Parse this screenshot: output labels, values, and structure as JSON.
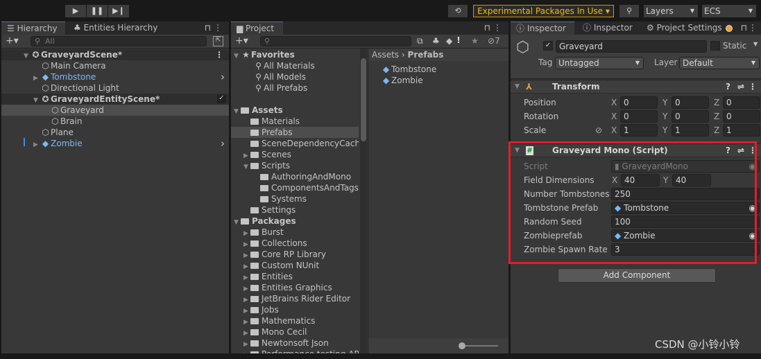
{
  "toolbar": {
    "play": "▶",
    "pause": "❚❚",
    "step": "▶❙",
    "history_icon": "history-icon",
    "experimental": "Experimental Packages In Use ▾",
    "search_icon": "search-icon",
    "layers": "Layers",
    "ecs": "ECS"
  },
  "hierarchy": {
    "tabs": [
      "Hierarchy",
      "Entities Hierarchy"
    ],
    "search_placeholder": "All",
    "rows": [
      {
        "label": "GraveyardScene*",
        "depth": 0,
        "kind": "scene",
        "expanded": true,
        "bold": true
      },
      {
        "label": "Main Camera",
        "depth": 1,
        "kind": "go"
      },
      {
        "label": "Tombstone",
        "depth": 1,
        "kind": "prefab",
        "collapsed": true
      },
      {
        "label": "Directional Light",
        "depth": 1,
        "kind": "go"
      },
      {
        "label": "GraveyardEntityScene*",
        "depth": 1,
        "kind": "scene",
        "expanded": true,
        "checked": true
      },
      {
        "label": "Graveyard",
        "depth": 2,
        "kind": "go",
        "selected": true
      },
      {
        "label": "Brain",
        "depth": 2,
        "kind": "go"
      },
      {
        "label": "Plane",
        "depth": 1,
        "kind": "go"
      },
      {
        "label": "Zombie",
        "depth": 1,
        "kind": "prefab",
        "collapsed": true
      }
    ]
  },
  "project": {
    "tab": "Project",
    "hidden_count": "7",
    "breadcrumb": [
      "Assets",
      "Prefabs"
    ],
    "tree": [
      {
        "label": "Favorites",
        "depth": 0,
        "kind": "star",
        "expanded": true,
        "bold": true
      },
      {
        "label": "All Materials",
        "depth": 1,
        "kind": "search"
      },
      {
        "label": "All Models",
        "depth": 1,
        "kind": "search"
      },
      {
        "label": "All Prefabs",
        "depth": 1,
        "kind": "search"
      },
      {
        "label": "",
        "depth": 0,
        "kind": "blank"
      },
      {
        "label": "Assets",
        "depth": 0,
        "kind": "folder",
        "expanded": true,
        "bold": true
      },
      {
        "label": "Materials",
        "depth": 1,
        "kind": "folder"
      },
      {
        "label": "Prefabs",
        "depth": 1,
        "kind": "folder",
        "selected": true
      },
      {
        "label": "SceneDependencyCache",
        "depth": 1,
        "kind": "folder"
      },
      {
        "label": "Scenes",
        "depth": 1,
        "kind": "folder",
        "collapsed": true
      },
      {
        "label": "Scripts",
        "depth": 1,
        "kind": "folder",
        "expanded": true
      },
      {
        "label": "AuthoringAndMono",
        "depth": 2,
        "kind": "folder"
      },
      {
        "label": "ComponentsAndTags",
        "depth": 2,
        "kind": "folder"
      },
      {
        "label": "Systems",
        "depth": 2,
        "kind": "folder"
      },
      {
        "label": "Settings",
        "depth": 1,
        "kind": "folder"
      },
      {
        "label": "Packages",
        "depth": 0,
        "kind": "folder",
        "expanded": true,
        "bold": true
      },
      {
        "label": "Burst",
        "depth": 1,
        "kind": "folder",
        "collapsed": true
      },
      {
        "label": "Collections",
        "depth": 1,
        "kind": "folder",
        "collapsed": true
      },
      {
        "label": "Core RP Library",
        "depth": 1,
        "kind": "folder",
        "collapsed": true
      },
      {
        "label": "Custom NUnit",
        "depth": 1,
        "kind": "folder",
        "collapsed": true
      },
      {
        "label": "Entities",
        "depth": 1,
        "kind": "folder",
        "collapsed": true
      },
      {
        "label": "Entities Graphics",
        "depth": 1,
        "kind": "folder",
        "collapsed": true
      },
      {
        "label": "JetBrains Rider Editor",
        "depth": 1,
        "kind": "folder",
        "collapsed": true
      },
      {
        "label": "Jobs",
        "depth": 1,
        "kind": "folder",
        "collapsed": true
      },
      {
        "label": "Mathematics",
        "depth": 1,
        "kind": "folder",
        "collapsed": true
      },
      {
        "label": "Mono Cecil",
        "depth": 1,
        "kind": "folder",
        "collapsed": true
      },
      {
        "label": "Newtonsoft Json",
        "depth": 1,
        "kind": "folder",
        "collapsed": true
      },
      {
        "label": "Performance testing API",
        "depth": 1,
        "kind": "folder",
        "collapsed": true
      }
    ],
    "items": [
      "Tombstone",
      "Zombie"
    ]
  },
  "inspector": {
    "tabs": [
      "Inspector",
      "Inspector",
      "Project Settings"
    ],
    "object": {
      "name": "Graveyard",
      "active": true,
      "static_label": "Static",
      "tag_label": "Tag",
      "tag": "Untagged",
      "layer_label": "Layer",
      "layer": "Default"
    },
    "transform": {
      "title": "Transform",
      "rows": [
        {
          "label": "Position",
          "x": "0",
          "y": "0",
          "z": "0"
        },
        {
          "label": "Rotation",
          "x": "0",
          "y": "0",
          "z": "0"
        },
        {
          "label": "Scale",
          "x": "1",
          "y": "1",
          "z": "1"
        }
      ]
    },
    "script": {
      "title": "Graveyard Mono (Script)",
      "script_label": "Script",
      "script_value": "GraveyardMono",
      "field_dimensions_label": "Field Dimensions",
      "fd_x": "40",
      "fd_y": "40",
      "number_tombstones_label": "Number Tombstones",
      "number_tombstones": "250",
      "tombstone_prefab_label": "Tombstone Prefab",
      "tombstone_prefab": "Tombstone",
      "random_seed_label": "Random Seed",
      "random_seed": "100",
      "zombieprefab_label": "Zombieprefab",
      "zombieprefab": "Zombie",
      "zombie_spawn_rate_label": "Zombie Spawn Rate",
      "zombie_spawn_rate": "3"
    },
    "add_component": "Add Component"
  },
  "axes": {
    "x": "X",
    "y": "Y",
    "z": "Z"
  },
  "watermark": "CSDN @小铃小铃",
  "colors": {
    "accent": "#3a79bb",
    "prefab": "#7bb8f5",
    "highlight": "#e81c24",
    "warning": "#f4bc02"
  }
}
